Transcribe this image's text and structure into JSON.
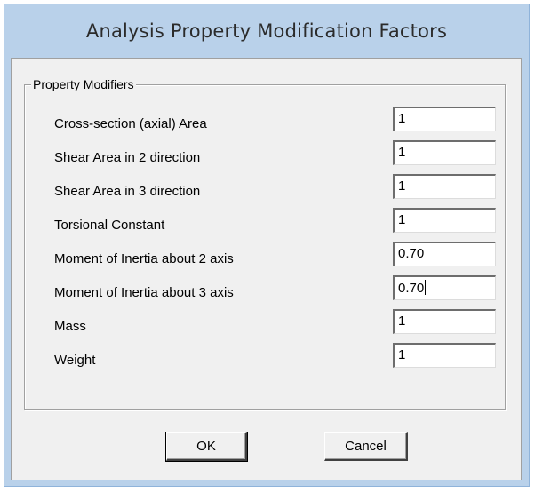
{
  "window": {
    "title": "Analysis Property Modification Factors"
  },
  "group": {
    "legend": "Property Modifiers"
  },
  "fields": [
    {
      "label": "Cross-section (axial) Area",
      "value": "1"
    },
    {
      "label": "Shear Area in 2 direction",
      "value": "1"
    },
    {
      "label": "Shear Area in 3 direction",
      "value": "1"
    },
    {
      "label": "Torsional Constant",
      "value": "1"
    },
    {
      "label": "Moment of Inertia about 2 axis",
      "value": "0.70"
    },
    {
      "label": "Moment of Inertia about 3 axis",
      "value": "0.70"
    },
    {
      "label": "Mass",
      "value": "1"
    },
    {
      "label": "Weight",
      "value": "1"
    }
  ],
  "buttons": {
    "ok": "OK",
    "cancel": "Cancel"
  },
  "colors": {
    "frame": "#b9d1ea",
    "client": "#f0f0f0",
    "field": "#ffffff"
  }
}
